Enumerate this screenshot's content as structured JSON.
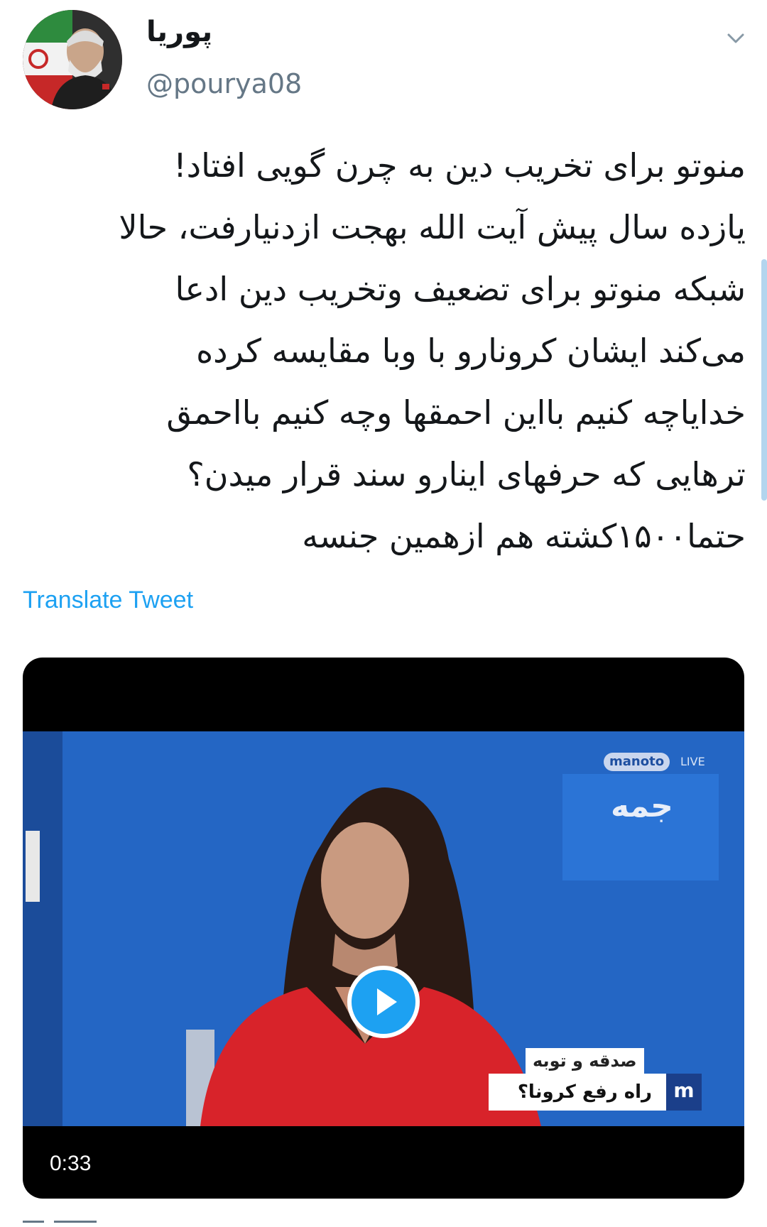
{
  "author": {
    "display_name": "پوریا",
    "handle": "@pourya08"
  },
  "tweet": {
    "lines": [
      "منوتو برای تخریب دین به چرن گویی افتاد!",
      "یازده سال پیش آیت الله بهجت ازدنیارفت، حالا",
      "شبکه منوتو برای تضعیف وتخریب دین ادعا",
      "می‌کند ایشان کرونارو با وبا مقایسه کرده",
      "خدایاچه کنیم بااین احمقها وچه کنیم بااحمق",
      "ترهایی که حرفهای اینارو سند قرار میدن؟",
      "حتما۱۵۰۰کشته هم ازهمین جنسه"
    ],
    "translate_label": "Translate Tweet"
  },
  "video": {
    "duration": "0:33",
    "channel_badge": "manoto",
    "channel_live": "LIVE",
    "channel_mark": "جمه",
    "ticker_top": "صدقه و توبه",
    "ticker_main": "راه رفع کرونا؟",
    "ticker_logo": "m"
  },
  "colors": {
    "accent": "#1da1f2",
    "text": "#14171a",
    "muted": "#657786",
    "video_bg": "#2467c6"
  },
  "icons": {
    "caret": "chevron-down-icon",
    "play": "play-icon"
  }
}
